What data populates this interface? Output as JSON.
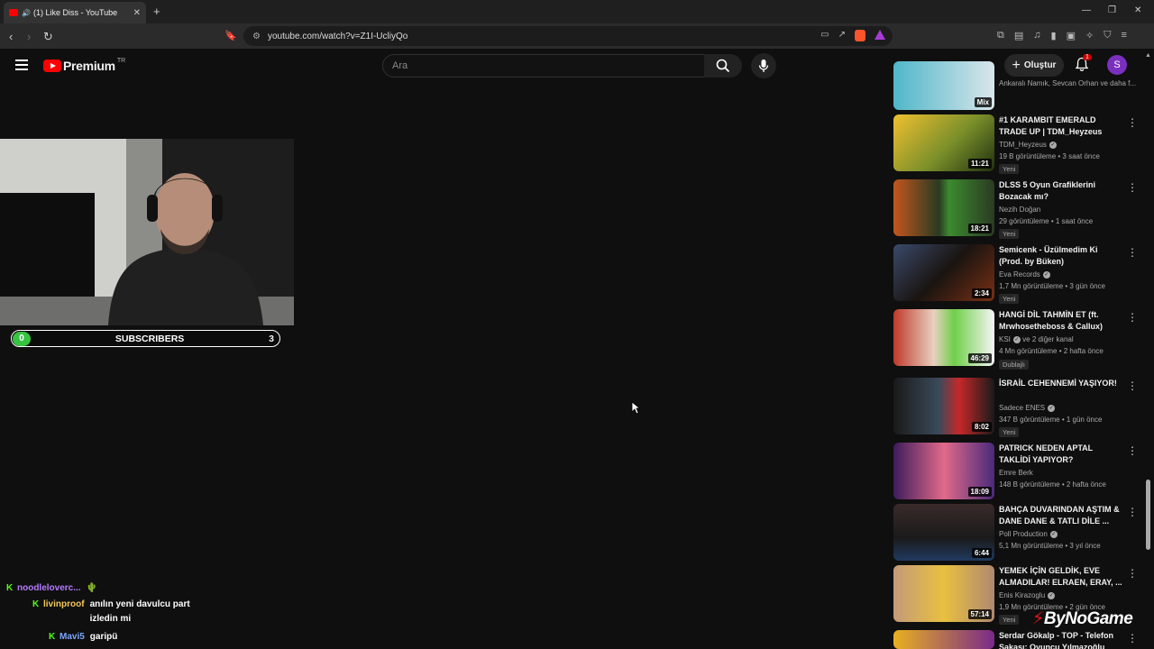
{
  "browser": {
    "tab_title": "(1) Like Diss - YouTube",
    "url": "youtube.com/watch?v=Z1I-UcliyQo",
    "new_tab": "+",
    "controls": {
      "minimize": "—",
      "restore": "❐",
      "close": "✕"
    }
  },
  "header": {
    "logo_word": "Premium",
    "logo_region": "TR",
    "search_placeholder": "Ara",
    "create_label": "Oluştur",
    "notifications_count": "1",
    "avatar_letter": "S"
  },
  "overlay": {
    "subscribers_label": "SUBSCRIBERS",
    "subscribers_start": "0",
    "subscribers_goal": "3"
  },
  "chat": [
    {
      "user": "noodleloverc...",
      "color": "#b57bff",
      "message": ""
    },
    {
      "user": "livinproof",
      "color": "#f3c85a",
      "message": "anılın yeni davulcu part izledin mi"
    },
    {
      "user": "Mavi5",
      "color": "#7aa7ff",
      "message": "garipü"
    }
  ],
  "sidebar": {
    "partial_top": {
      "channel": "Ankaralı Namık, Sevcan Orhan ve daha f...",
      "badge": "Mix"
    },
    "videos": [
      {
        "title": "#1 KARAMBIT EMERALD TRADE UP | TDM_Heyzeus",
        "channel": "TDM_Heyzeus",
        "verified": true,
        "meta": "19 B görüntüleme • 3 saat önce",
        "badge": "Yeni",
        "duration": "11:21"
      },
      {
        "title": "DLSS 5 Oyun Grafiklerini Bozacak mı?",
        "channel": "Nezih Doğan",
        "verified": false,
        "meta": "29 görüntüleme • 1 saat önce",
        "badge": "Yeni",
        "duration": "18:21"
      },
      {
        "title": "Semicenk - Üzülmedim Ki (Prod. by Büken)",
        "channel": "Eva Records",
        "verified": true,
        "meta": "1,7 Mn görüntüleme • 3 gün önce",
        "badge": "Yeni",
        "duration": "2:34"
      },
      {
        "title": "HANGİ DİL TAHMİN ET (ft. Mrwhosetheboss & Callux)",
        "channel": "KSI",
        "verified": true,
        "channel_extra": "ve 2 diğer kanal",
        "meta": "4 Mn görüntüleme • 2 hafta önce",
        "badge": "Dublajlı",
        "duration": "46:29"
      },
      {
        "title": "İSRAİL CEHENNEMİ YAŞIYOR!",
        "channel": "Sadece ENES",
        "verified": true,
        "meta": "347 B görüntüleme • 1 gün önce",
        "badge": "Yeni",
        "duration": "8:02"
      },
      {
        "title": "PATRICK NEDEN APTAL TAKLİDİ YAPIYOR?",
        "channel": "Emre Berk",
        "verified": false,
        "meta": "148 B görüntüleme • 2 hafta önce",
        "badge": "",
        "duration": "18:09"
      },
      {
        "title": "BAHÇA DUVARINDAN AŞTIM & DANE DANE & TATLI DİLE ...",
        "channel": "Poll Production",
        "verified": true,
        "meta": "5,1 Mn görüntüleme • 3 yıl önce",
        "badge": "",
        "duration": "6:44"
      },
      {
        "title": "YEMEK İÇİN GELDİK, EVE ALMADILAR! ELRAEN, ERAY, ...",
        "channel": "Enis Kirazoglu",
        "verified": true,
        "meta": "1,9 Mn görüntüleme • 2 gün önce",
        "badge": "Yeni",
        "duration": "57:14"
      },
      {
        "title": "Serdar Gökalp - TOP - Telefon Şakası: Oyuncu Yılmazoğlu",
        "channel": "",
        "verified": false,
        "meta": "",
        "badge": "",
        "duration": ""
      }
    ]
  },
  "watermark": "ByNoGame",
  "colors": {
    "youtube_red": "#ff0000",
    "kick_green": "#53fc18",
    "sub_green": "#35c441",
    "avatar_purple": "#7b2fbf"
  }
}
